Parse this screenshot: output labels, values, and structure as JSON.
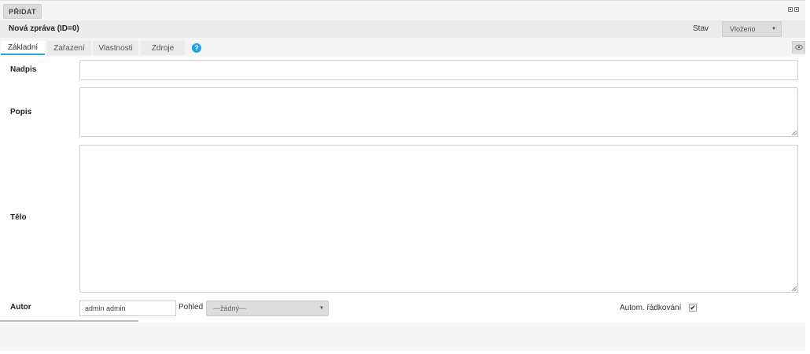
{
  "toolbar": {
    "add_label": "PŘIDAT"
  },
  "header": {
    "title": "Nová zpráva (ID=0)",
    "status_label": "Stav",
    "status_value": "Vloženo"
  },
  "tabs": [
    {
      "label": "Základní",
      "active": true
    },
    {
      "label": "Zařazení",
      "active": false
    },
    {
      "label": "Vlastnosti",
      "active": false
    },
    {
      "label": "Zdroje",
      "active": false
    }
  ],
  "help_glyph": "?",
  "form": {
    "heading_label": "Nadpis",
    "heading_value": "",
    "description_label": "Popis",
    "description_value": "",
    "body_label": "Tělo",
    "body_value": "",
    "author_label": "Autor",
    "author_value": "admin admin",
    "view_label": "Pohled",
    "view_value": "---žádný---",
    "autowrap_label": "Autom. řádkování",
    "autowrap_checked": true
  },
  "colors": {
    "accent": "#29a7e1",
    "help": "#1fa3e5"
  },
  "icons": [
    "help-icon",
    "eye-icon",
    "chevron-down-icon",
    "checkmark-icon",
    "window-icon"
  ]
}
